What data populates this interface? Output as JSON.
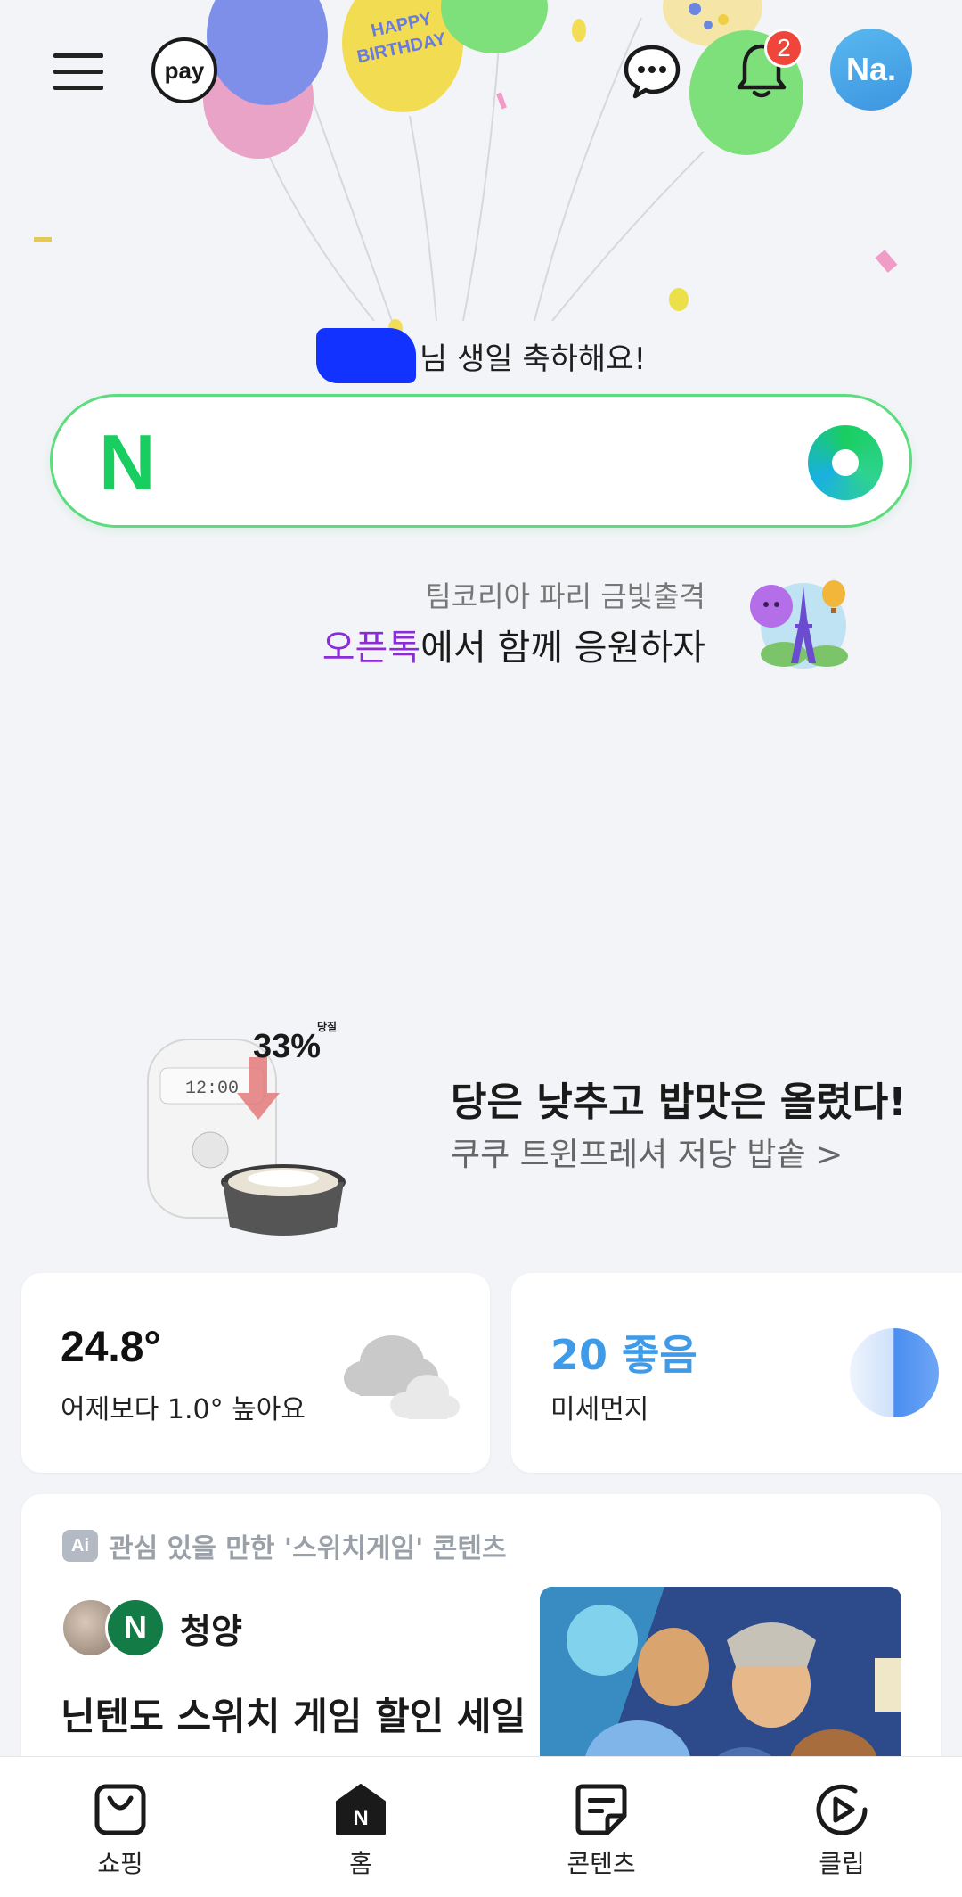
{
  "header": {
    "pay_label": "pay",
    "notification_count": "2",
    "avatar_text": "Na."
  },
  "greeting": {
    "text": "님 생일 축하해요!"
  },
  "search": {
    "logo": "N",
    "placeholder": ""
  },
  "promo": {
    "subtitle": "팀코리아 파리 금빛출격",
    "title_highlight": "오픈톡",
    "title_rest": "에서 함께 응원하자"
  },
  "ad": {
    "badge_percent": "33%",
    "badge_small": "당질",
    "title": "당은 낮추고 밥맛은 올렸다!",
    "subtitle": "쿠쿠 트윈프레셔 저당 밥솥 >"
  },
  "weather": {
    "temperature": "24.8°",
    "description": "어제보다 1.0° 높아요"
  },
  "dust": {
    "value": "20 좋음",
    "label": "미세먼지"
  },
  "content": {
    "ai_badge": "Ai",
    "header": "관심 있을 만한 '스위치게임' 콘텐츠",
    "author": "청양",
    "author_badge": "N",
    "title": "닌텐도 스위치 게임 할인 세일"
  },
  "bottom_nav": {
    "items": [
      {
        "label": "쇼핑",
        "icon": "shopping-bag-icon"
      },
      {
        "label": "홈",
        "icon": "home-icon"
      },
      {
        "label": "콘텐츠",
        "icon": "contents-icon"
      },
      {
        "label": "클립",
        "icon": "clip-play-icon"
      }
    ]
  },
  "colors": {
    "brand_green": "#19ce60",
    "search_border": "#5ddc7f",
    "badge_red": "#f0453a",
    "dust_blue": "#3f9be8",
    "highlight_purple": "#8c2bd8"
  }
}
